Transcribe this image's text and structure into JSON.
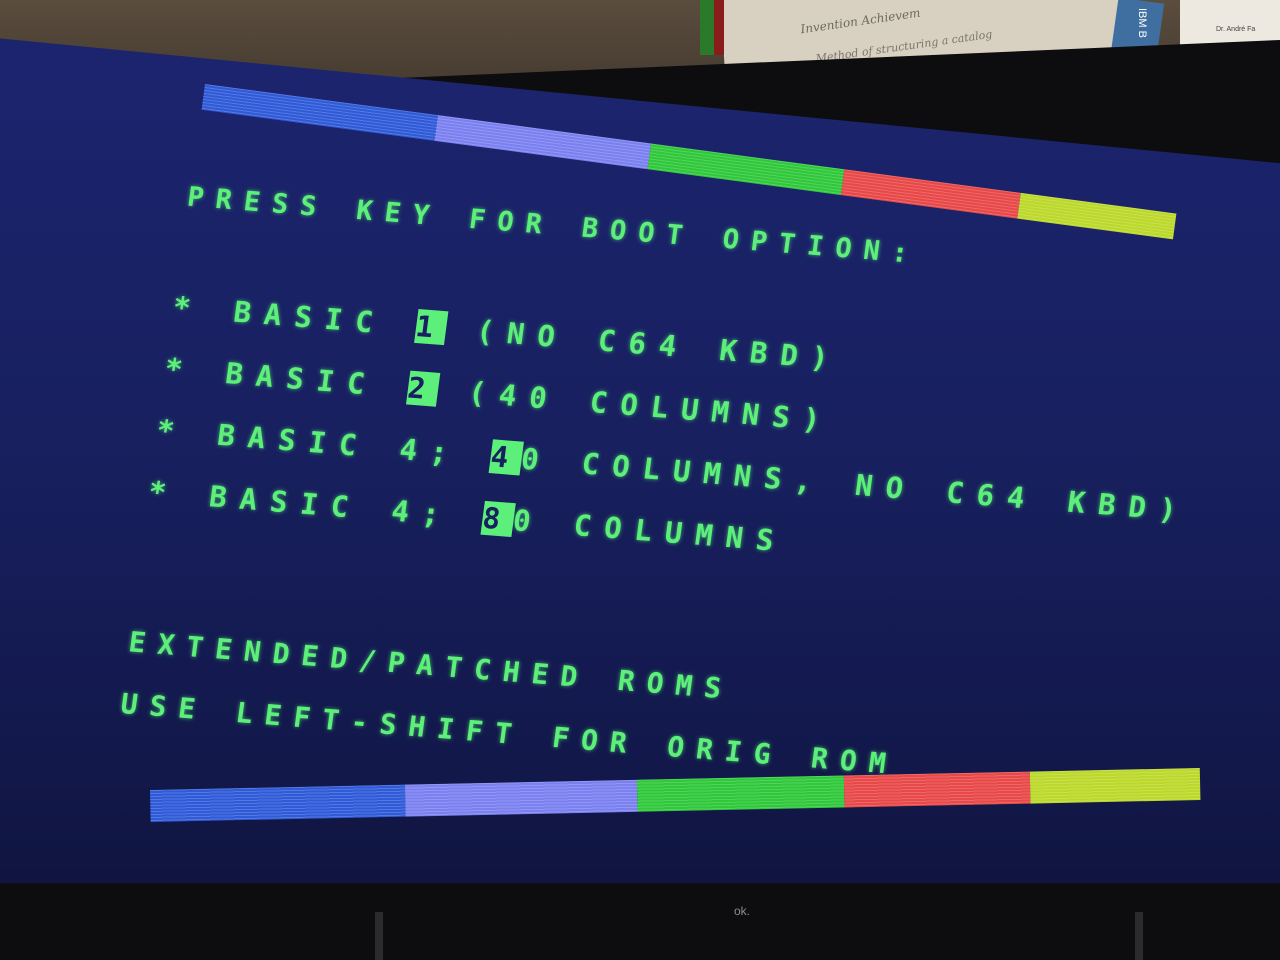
{
  "background": {
    "paper_line_1": "Invention Achievem",
    "paper_line_2": "Method of structuring a catalog",
    "card_text": "Dr. André Fa",
    "lanyard_text": "IBM B",
    "monitor_brand": "ok."
  },
  "screen": {
    "heading": "PRESS KEY FOR BOOT OPTION:",
    "options": [
      {
        "bullet": "*",
        "label": "BASIC ",
        "key": "1",
        "desc": " (NO C64 KBD)"
      },
      {
        "bullet": "*",
        "label": "BASIC ",
        "key": "2",
        "desc": " (40 COLUMNS)"
      },
      {
        "bullet": "*",
        "label": "BASIC 4; ",
        "key": "4",
        "desc": "0 COLUMNS, NO C64 KBD)"
      },
      {
        "bullet": "*",
        "label": "BASIC 4; ",
        "key": "8",
        "desc": "0 COLUMNS"
      }
    ],
    "note_1": "EXTENDED/PATCHED ROMS",
    "note_2": "USE LEFT-SHIFT FOR ORIG ROM"
  },
  "colors": {
    "text": "#5cf07a",
    "screen_bg": "#182060",
    "bar_blue": "#2f5ad8",
    "bar_lavender": "#7a80f0",
    "bar_green": "#2fc83a",
    "bar_red": "#e84848",
    "bar_yellow": "#bcd82a"
  }
}
